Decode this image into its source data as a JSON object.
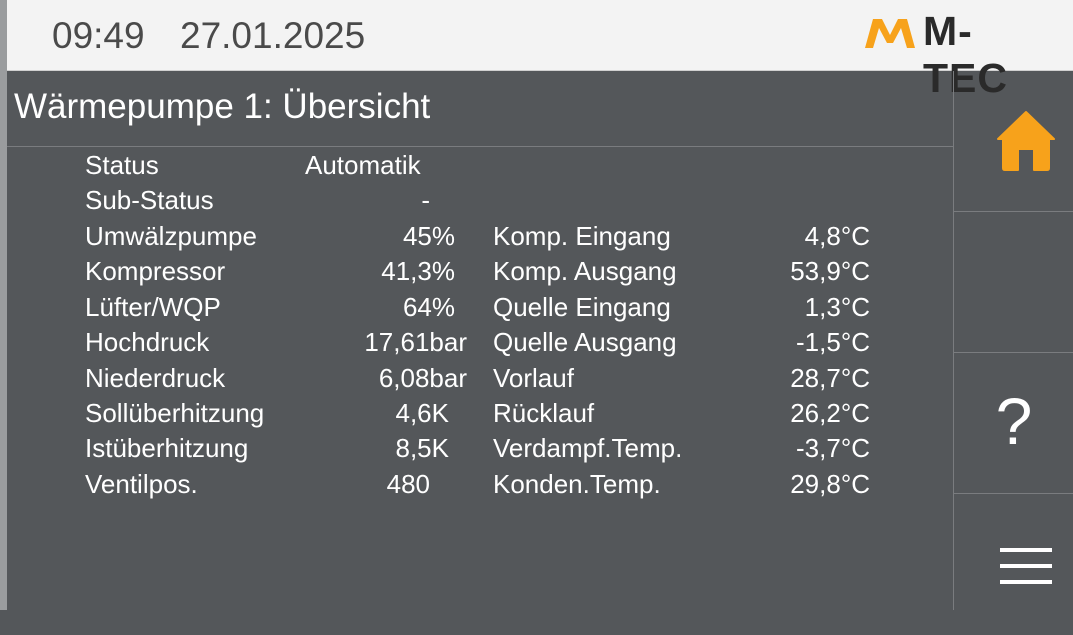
{
  "header": {
    "time": "09:49",
    "date": "27.01.2025",
    "logo_text": "M-TEC",
    "logo_accent_color": "#f7a21b"
  },
  "page": {
    "title": "Wärmepumpe 1: Übersicht"
  },
  "left_table": [
    {
      "label": "Status",
      "value": "Automatik"
    },
    {
      "label": "Sub-Status",
      "value": "-"
    },
    {
      "label": "Umwälzpumpe",
      "value": "45%"
    },
    {
      "label": "Kompressor",
      "value": "41,3%"
    },
    {
      "label": "Lüfter/WQP",
      "value": "64%"
    },
    {
      "label": "Hochdruck",
      "value": "17,61bar"
    },
    {
      "label": "Niederdruck",
      "value": "6,08bar"
    },
    {
      "label": "Sollüberhitzung",
      "value": "4,6K"
    },
    {
      "label": "Istüberhitzung",
      "value": "8,5K"
    },
    {
      "label": "Ventilpos.",
      "value": "480"
    }
  ],
  "right_table": [
    {
      "label": "Komp. Eingang",
      "value": "4,8°C"
    },
    {
      "label": "Komp. Ausgang",
      "value": "53,9°C"
    },
    {
      "label": "Quelle Eingang",
      "value": "1,3°C"
    },
    {
      "label": "Quelle Ausgang",
      "value": "-1,5°C"
    },
    {
      "label": "Vorlauf",
      "value": "28,7°C"
    },
    {
      "label": "Rücklauf",
      "value": "26,2°C"
    },
    {
      "label": "Verdampf.Temp.",
      "value": "-3,7°C"
    },
    {
      "label": "Konden.Temp.",
      "value": "29,8°C"
    }
  ],
  "sidebar": {
    "home_icon": "home-icon",
    "home_icon_color": "#f7a21b",
    "help_label": "?",
    "menu_icon": "hamburger-menu-icon"
  }
}
